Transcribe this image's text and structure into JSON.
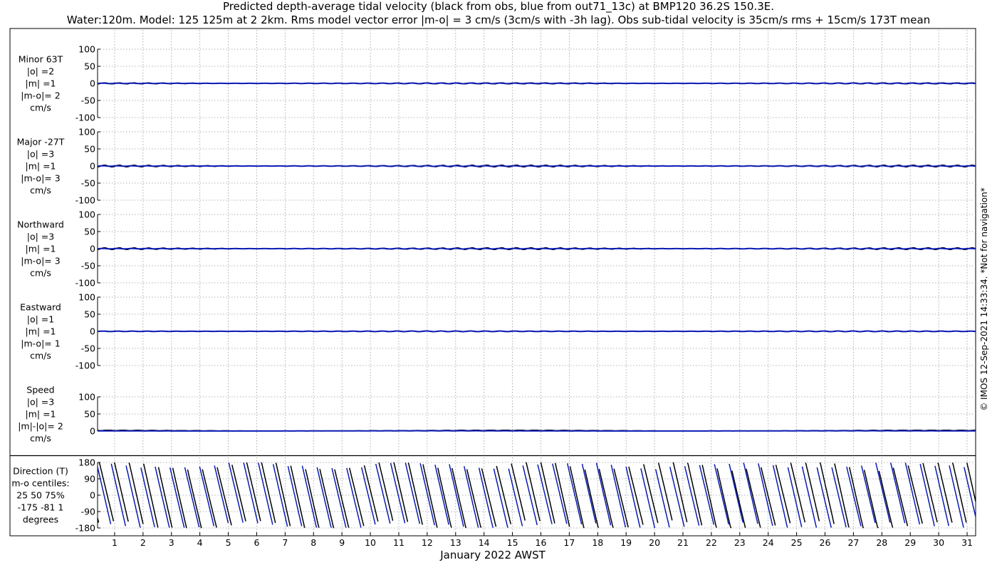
{
  "title": {
    "line1": "Predicted depth-average tidal velocity (black from obs, blue from out71_13c) at BMP120 36.2S 150.3E.",
    "line2": "Water:120m. Model: 125 125m at 2 2km. Rms model vector error |m-o| = 3 cm/s (3cm/s with -3h lag). Obs sub-tidal velocity is 35cm/s rms + 15cm/s 173T mean"
  },
  "credit": "© IMOS 12-Sep-2021 14:33:34. *Not for navigation*",
  "colors": {
    "obs": "#000000",
    "model": "#0a1ab4",
    "grid": "#9a9a9a",
    "axis": "#000000"
  },
  "chart_data": [
    {
      "type": "line",
      "panel": "minor",
      "label_lines": [
        "Minor 63T",
        "|o| =2",
        "|m| =1",
        "|m-o|= 2",
        "cm/s"
      ],
      "ylim": [
        -100,
        100
      ],
      "yticks": [
        100,
        50,
        0,
        -50,
        -100
      ],
      "ytick_labels": [
        "100",
        "50",
        "0",
        "-50",
        "-100"
      ],
      "series": [
        {
          "name": "obs",
          "amplitude": 2,
          "period_days": 0.5175
        },
        {
          "name": "out71_13c",
          "amplitude": 1,
          "period_days": 0.5175
        }
      ]
    },
    {
      "type": "line",
      "panel": "major",
      "label_lines": [
        "Major -27T",
        "|o| =3",
        "|m| =1",
        "|m-o|= 3",
        "cm/s"
      ],
      "ylim": [
        -100,
        100
      ],
      "yticks": [
        100,
        50,
        0,
        -50,
        -100
      ],
      "ytick_labels": [
        "100",
        "50",
        "0",
        "-50",
        "-100"
      ],
      "series": [
        {
          "name": "obs",
          "amplitude": 3,
          "period_days": 0.5175
        },
        {
          "name": "out71_13c",
          "amplitude": 1,
          "period_days": 0.5175
        }
      ]
    },
    {
      "type": "line",
      "panel": "northward",
      "label_lines": [
        "Northward",
        "|o| =3",
        "|m| =1",
        "|m-o|= 3",
        "cm/s"
      ],
      "ylim": [
        -100,
        100
      ],
      "yticks": [
        100,
        50,
        0,
        -50,
        -100
      ],
      "ytick_labels": [
        "100",
        "50",
        "0",
        "-50",
        "-100"
      ],
      "series": [
        {
          "name": "obs",
          "amplitude": 3,
          "period_days": 0.5175
        },
        {
          "name": "out71_13c",
          "amplitude": 1,
          "period_days": 0.5175
        }
      ]
    },
    {
      "type": "line",
      "panel": "eastward",
      "label_lines": [
        "Eastward",
        "|o| =1",
        "|m| =1",
        "|m-o|= 1",
        "cm/s"
      ],
      "ylim": [
        -100,
        100
      ],
      "yticks": [
        100,
        50,
        0,
        -50,
        -100
      ],
      "ytick_labels": [
        "100",
        "50",
        "0",
        "-50",
        "-100"
      ],
      "series": [
        {
          "name": "obs",
          "amplitude": 1,
          "period_days": 0.5175
        },
        {
          "name": "out71_13c",
          "amplitude": 1,
          "period_days": 0.5175
        }
      ]
    },
    {
      "type": "line",
      "panel": "speed",
      "label_lines": [
        "Speed",
        "|o| =3",
        "|m| =1",
        "|m|-|o|= 2",
        "cm/s"
      ],
      "ylim": [
        0,
        100
      ],
      "yticks": [
        100,
        50,
        0
      ],
      "ytick_labels": [
        "100",
        "50",
        "0"
      ],
      "series": [
        {
          "name": "obs",
          "amplitude": 3,
          "period_days": 0.5175
        },
        {
          "name": "out71_13c",
          "amplitude": 1,
          "period_days": 0.5175
        }
      ]
    },
    {
      "type": "line",
      "panel": "direction",
      "label_lines": [
        "Direction (T)",
        "m-o centiles:",
        "25  50  75%",
        "-175  -81    1",
        "degrees"
      ],
      "ylim": [
        -180,
        180
      ],
      "yticks": [
        180,
        90,
        0,
        -90,
        -180
      ],
      "ytick_labels": [
        "180",
        "90",
        "0",
        "-90",
        "-180"
      ],
      "series": [
        {
          "name": "obs",
          "period_days": 0.5175
        },
        {
          "name": "out71_13c",
          "period_days": 0.5175
        }
      ]
    }
  ],
  "xaxis": {
    "label": "January 2022 AWST",
    "range_days": [
      0.4,
      31.3
    ],
    "ticks": [
      "1",
      "2",
      "3",
      "4",
      "5",
      "6",
      "7",
      "8",
      "9",
      "10",
      "11",
      "12",
      "13",
      "14",
      "15",
      "16",
      "17",
      "18",
      "19",
      "20",
      "21",
      "22",
      "23",
      "24",
      "25",
      "26",
      "27",
      "28",
      "29",
      "30",
      "31"
    ]
  }
}
